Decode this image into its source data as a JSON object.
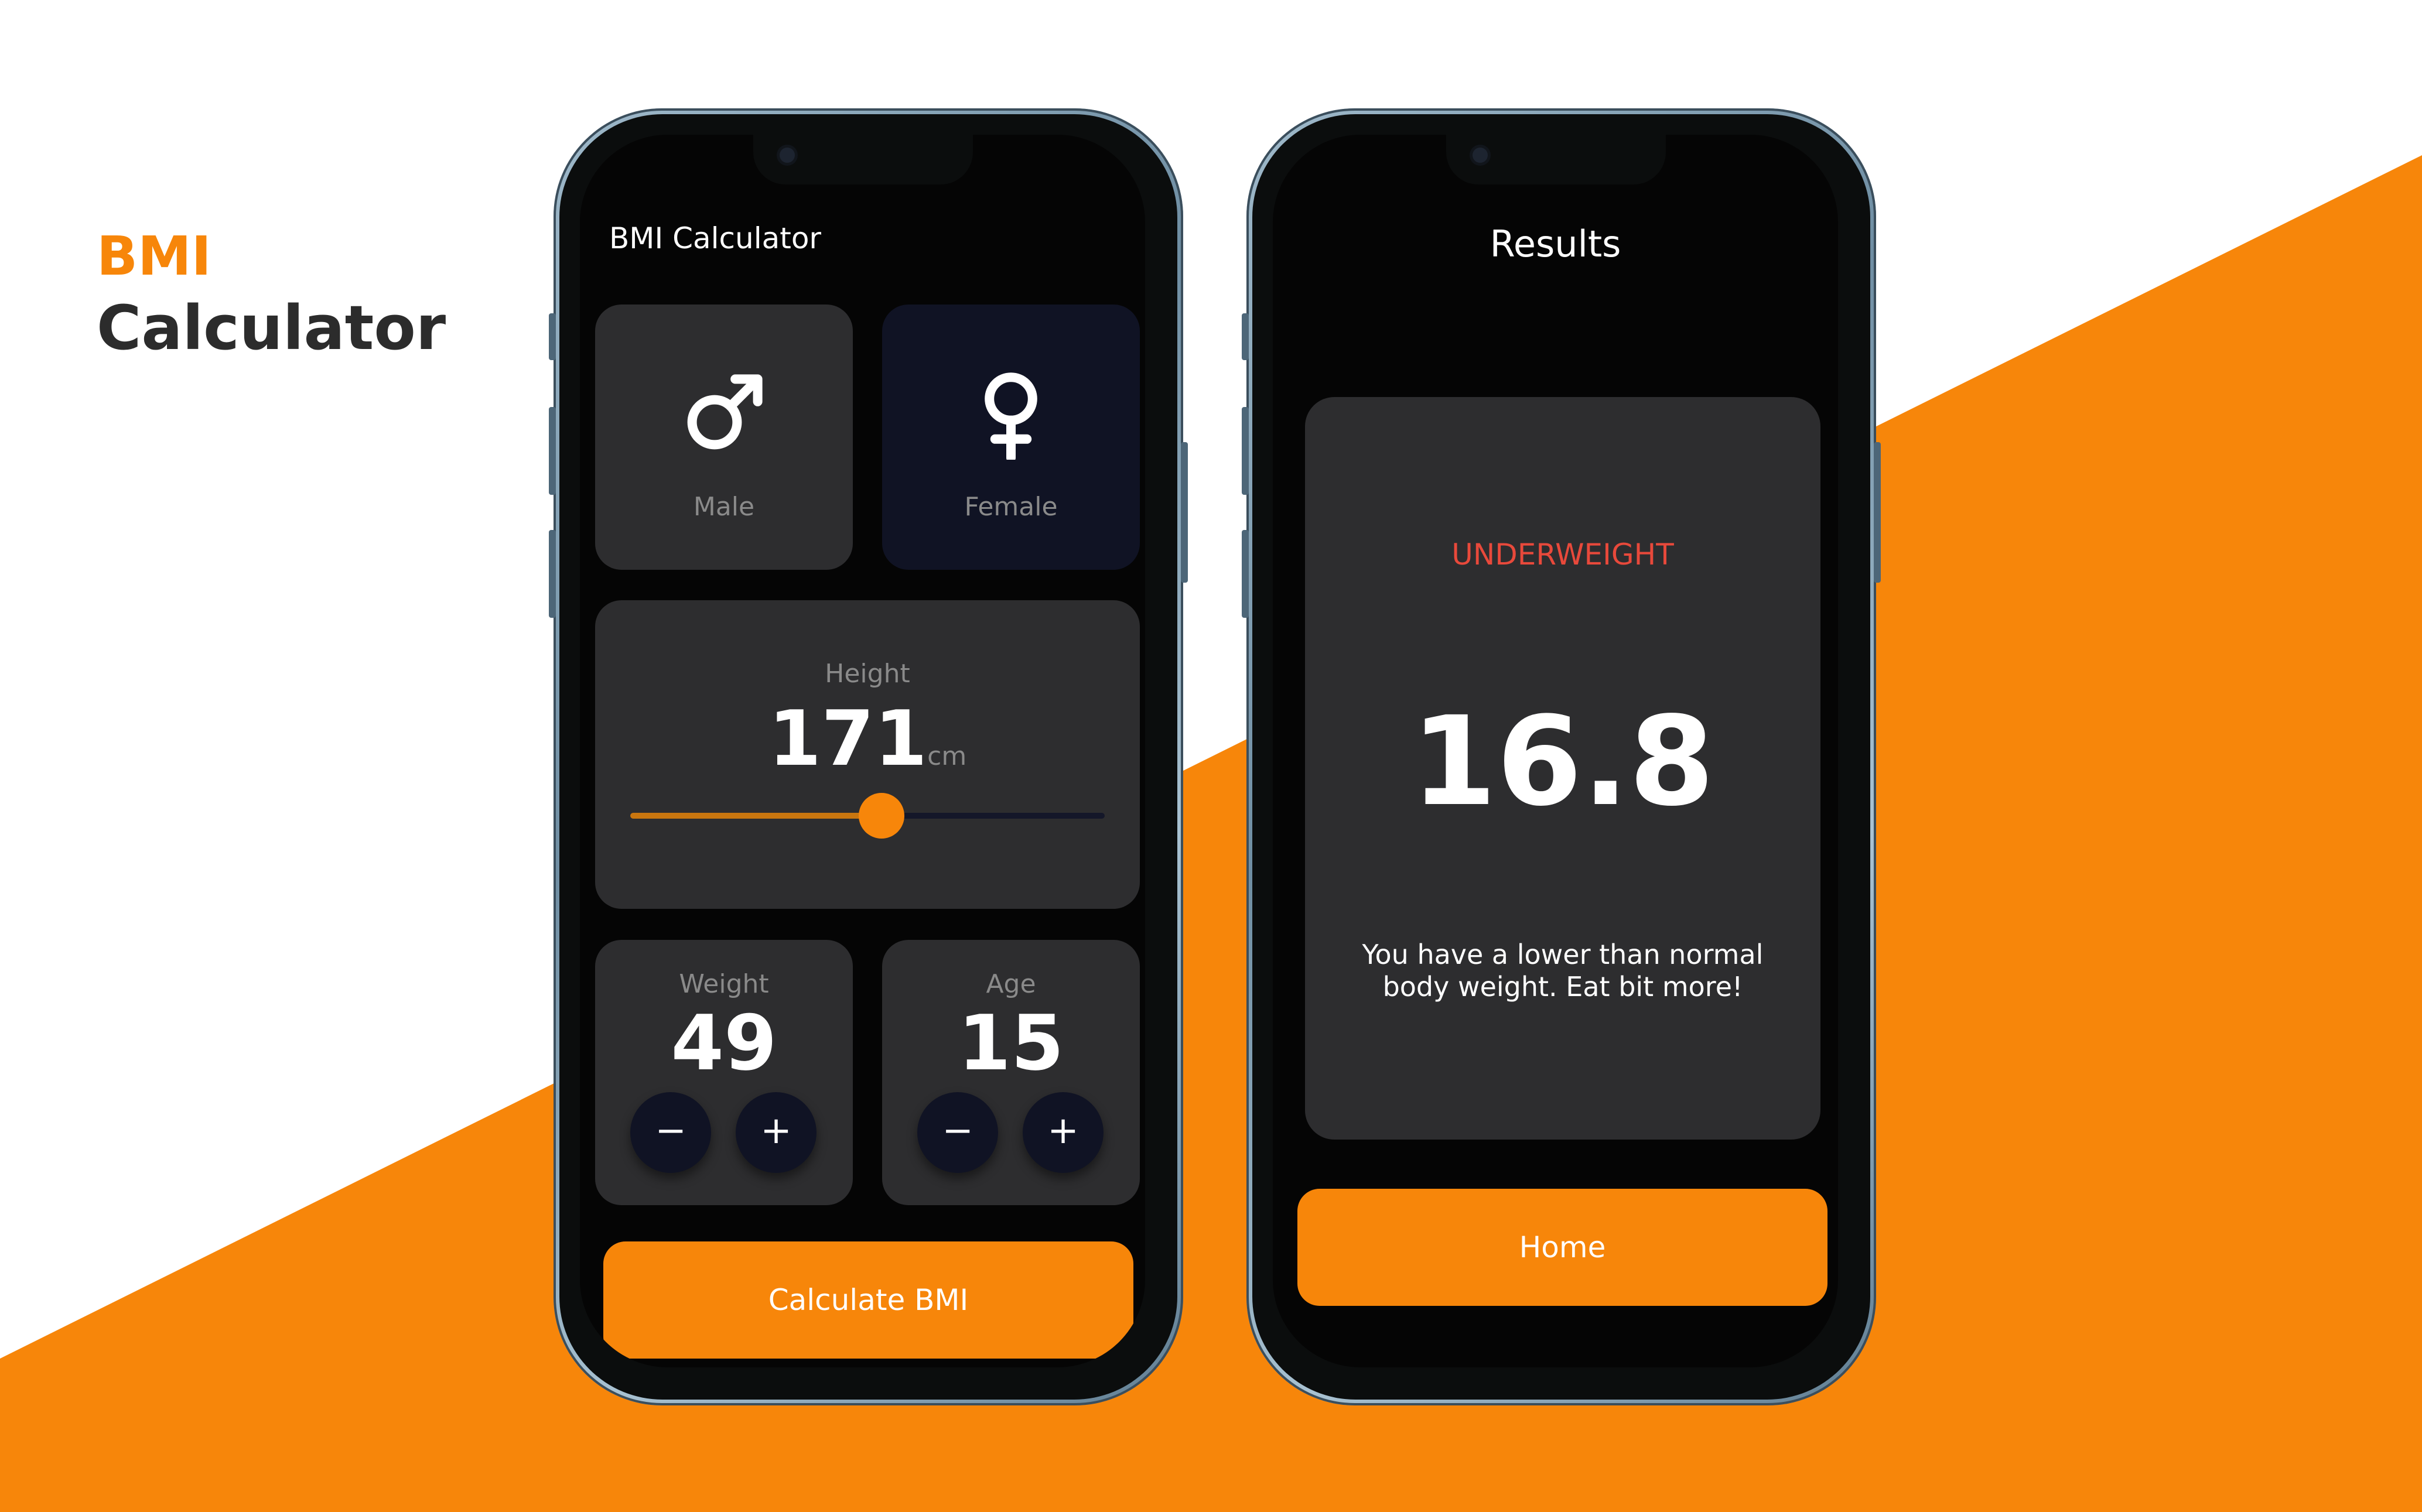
{
  "headline": {
    "line1": "BMI",
    "line2": "Calculator"
  },
  "colors": {
    "accent": "#F7860A",
    "danger": "#E8493B",
    "card": "#2d2d2f",
    "selected_card": "#101324",
    "screen": "#050505"
  },
  "calculator": {
    "title": "BMI Calculator",
    "gender": {
      "male": {
        "label": "Male",
        "icon": "male-symbol-icon",
        "selected": false
      },
      "female": {
        "label": "Female",
        "icon": "female-symbol-icon",
        "selected": true
      }
    },
    "height": {
      "label": "Height",
      "value": "171",
      "unit": "cm",
      "slider_fraction": 0.53
    },
    "weight": {
      "label": "Weight",
      "value": "49",
      "minus": "−",
      "plus": "+"
    },
    "age": {
      "label": "Age",
      "value": "15",
      "minus": "−",
      "plus": "+"
    },
    "cta_label": "Calculate BMI"
  },
  "results": {
    "title": "Results",
    "status": "UNDERWEIGHT",
    "bmi": "16.8",
    "message": "You have a lower than normal body weight. Eat bit more!",
    "home_label": "Home"
  }
}
